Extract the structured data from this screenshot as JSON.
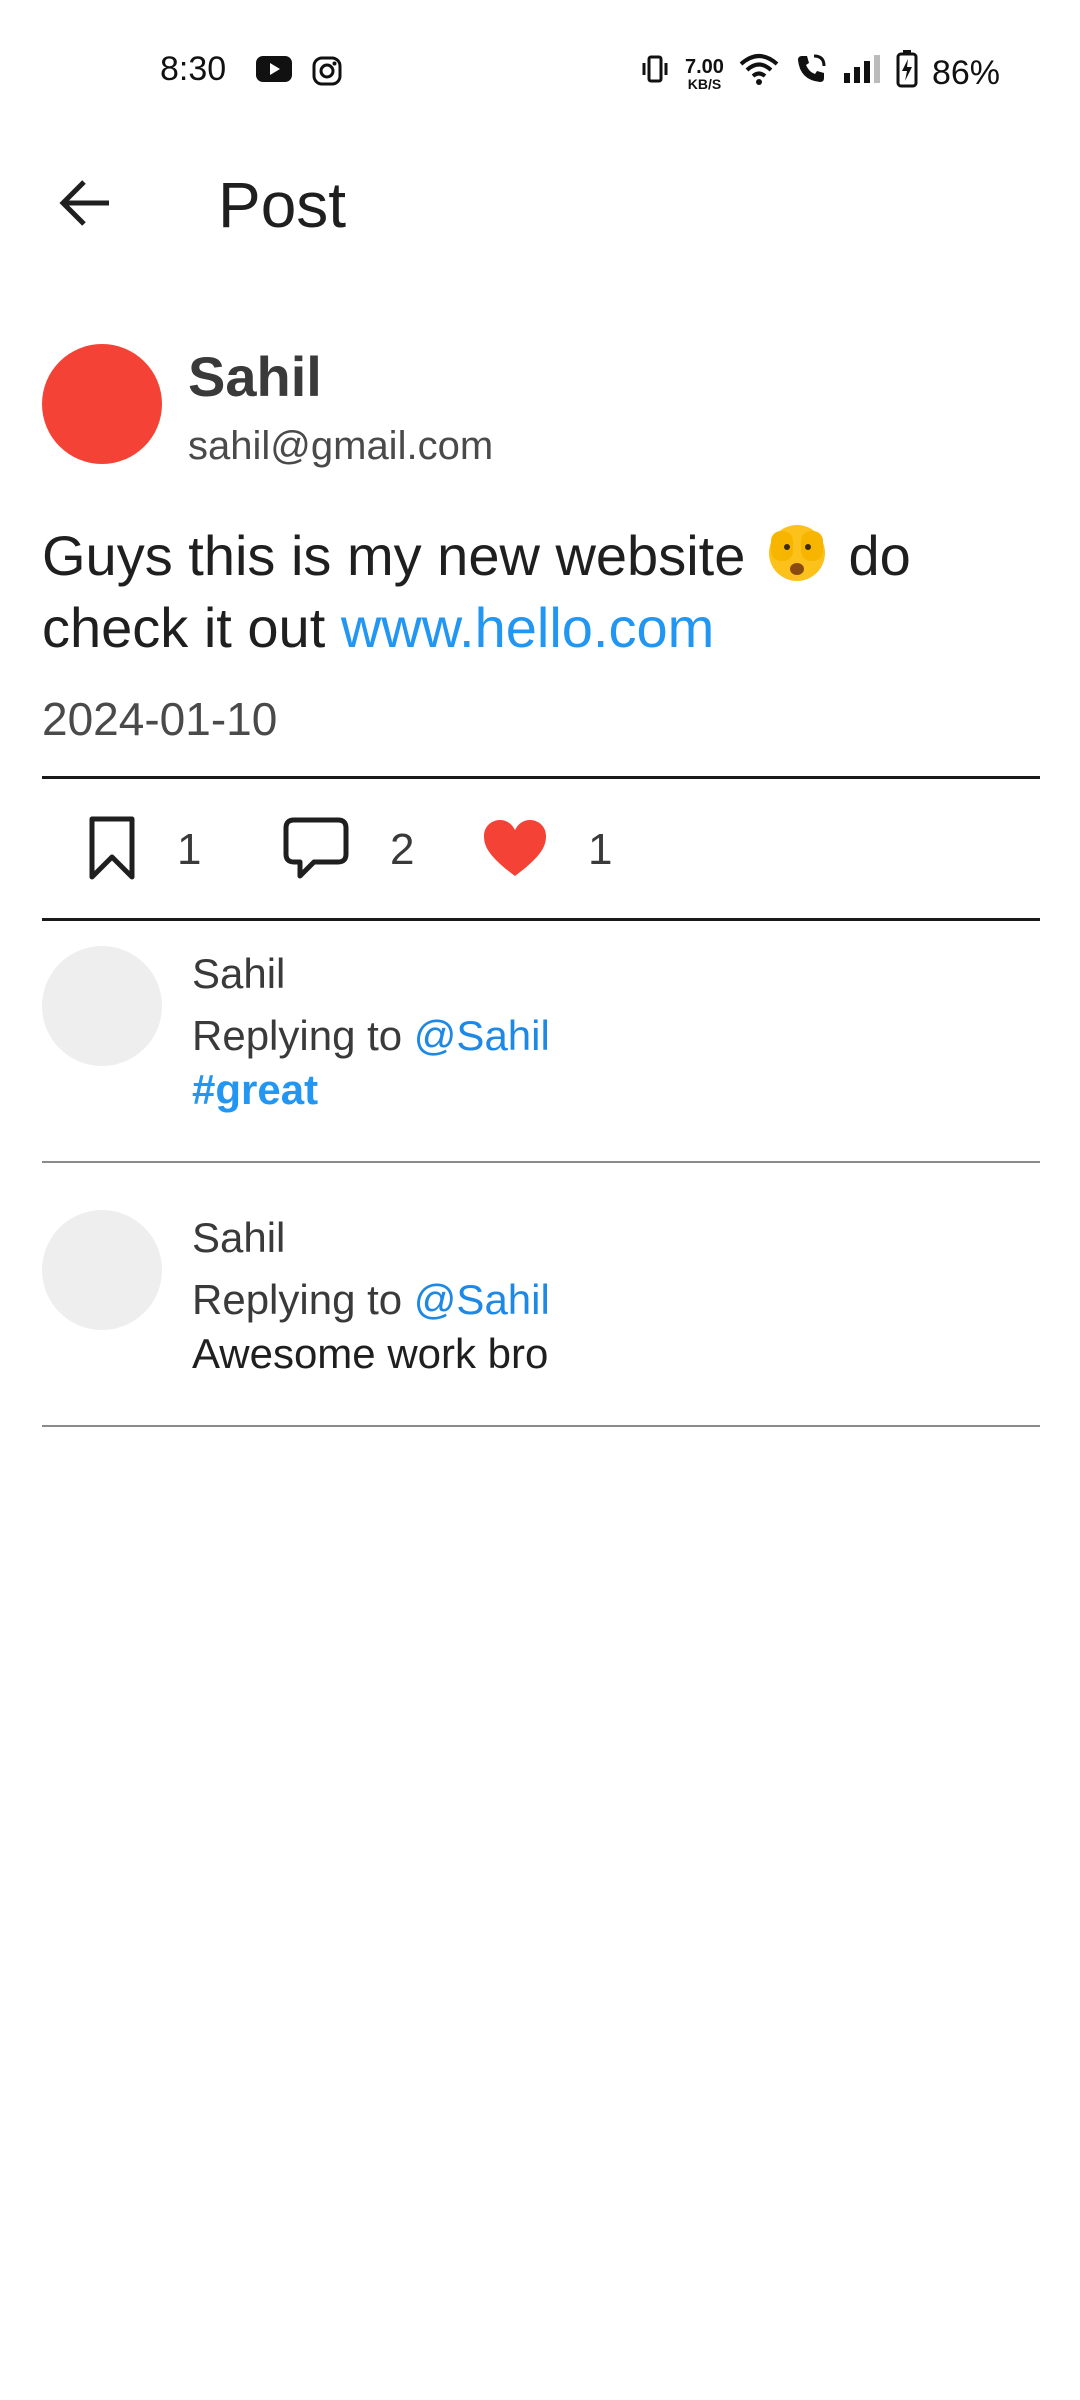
{
  "status_bar": {
    "time": "8:30",
    "netspeed_value": "7.00",
    "netspeed_unit": "KB/S",
    "battery": "86%",
    "icons": [
      "youtube-icon",
      "instagram-icon",
      "vibrate-icon",
      "wifi-icon",
      "wifi-call-icon",
      "signal-icon",
      "battery-charging-icon"
    ]
  },
  "app_bar": {
    "title": "Post",
    "back_icon": "arrow-left-icon"
  },
  "post": {
    "author_name": "Sahil",
    "author_email": "sahil@gmail.com",
    "avatar_color": "#f44336",
    "text_part1": "Guys this is my new website ",
    "emoji": "face-with-peeking-eye",
    "text_part2": " do check it out ",
    "link": "www.hello.com",
    "date": "2024-01-10",
    "bookmarks": "1",
    "comments": "2",
    "likes": "1"
  },
  "replies": [
    {
      "author": "Sahil",
      "replying_prefix": "Replying to ",
      "mention": "@Sahil",
      "body": "#great",
      "body_is_hashtag": true
    },
    {
      "author": "Sahil",
      "replying_prefix": "Replying to ",
      "mention": "@Sahil",
      "body": "Awesome work bro",
      "body_is_hashtag": false
    }
  ],
  "colors": {
    "link": "#2196f3",
    "mention": "#1e88e5",
    "like": "#f44336",
    "reply_avatar": "#eeeeee"
  }
}
